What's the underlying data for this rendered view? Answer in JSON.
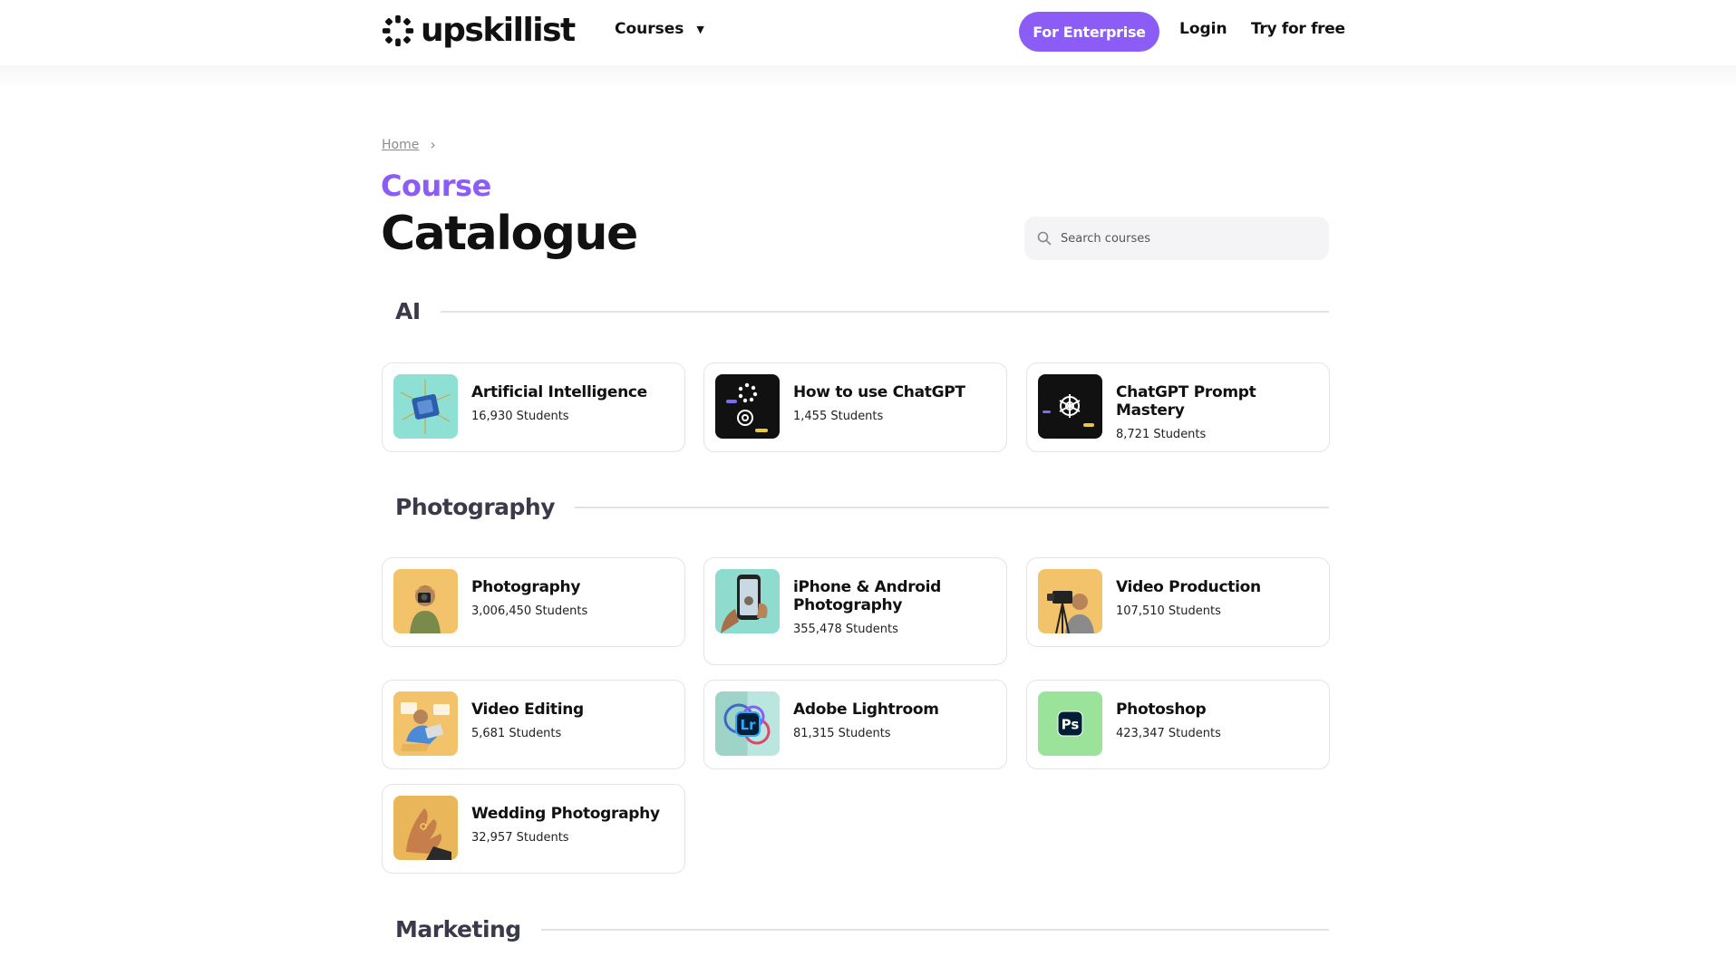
{
  "header": {
    "logo_text": "upskillist",
    "nav_courses": "Courses",
    "enterprise_button": "For Enterprise",
    "login": "Login",
    "try_free": "Try for free"
  },
  "breadcrumb": {
    "home": "Home"
  },
  "heading": {
    "line1": "Course",
    "line2": "Catalogue"
  },
  "search": {
    "placeholder": "Search courses"
  },
  "sections": [
    {
      "name": "AI",
      "courses": [
        {
          "title": "Artificial Intelligence",
          "students": "16,930 Students",
          "thumb": "ai-chip"
        },
        {
          "title": "How to use ChatGPT",
          "students": "1,455 Students",
          "thumb": "chatgpt-logo"
        },
        {
          "title": "ChatGPT Prompt Mastery",
          "students": "8,721 Students",
          "thumb": "chatgpt-logo"
        }
      ]
    },
    {
      "name": "Photography",
      "courses": [
        {
          "title": "Photography",
          "students": "3,006,450 Students",
          "thumb": "photographer"
        },
        {
          "title": "iPhone & Android Photography",
          "students": "355,478 Students",
          "thumb": "phone-camera"
        },
        {
          "title": "Video Production",
          "students": "107,510 Students",
          "thumb": "video-camera"
        },
        {
          "title": "Video Editing",
          "students": "5,681 Students",
          "thumb": "video-editor"
        },
        {
          "title": "Adobe Lightroom",
          "students": "81,315 Students",
          "thumb": "lightroom-logo",
          "thumb_text": "Lr"
        },
        {
          "title": "Photoshop",
          "students": "423,347 Students",
          "thumb": "photoshop-logo",
          "thumb_text": "Ps"
        },
        {
          "title": "Wedding Photography",
          "students": "32,957 Students",
          "thumb": "wedding-hands"
        }
      ]
    },
    {
      "name": "Marketing",
      "courses": []
    }
  ],
  "colors": {
    "accent": "#8b5cf6",
    "text": "#111111",
    "muted": "#8a8a96"
  }
}
